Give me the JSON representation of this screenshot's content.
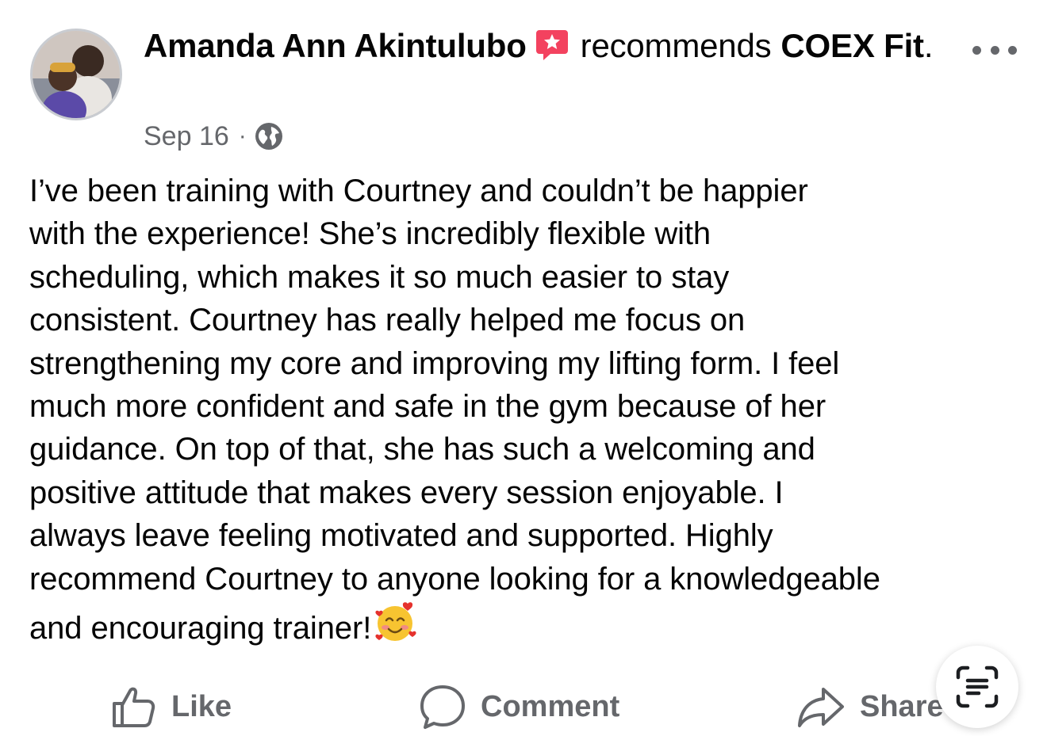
{
  "post": {
    "author": "Amanda Ann Akintulubo",
    "action_text": "recommends",
    "page_name": "COEX Fit",
    "date": "Sep 16",
    "separator": "·",
    "audience_icon": "globe-icon",
    "body_lines": [
      "I’ve been training with Courtney and couldn’t be happier",
      "with the experience! She’s incredibly flexible with",
      "scheduling, which makes it so much easier to stay",
      "consistent. Courtney has really helped me focus on",
      "strengthening my core and improving my lifting form. I feel",
      "much more confident and safe in the gym because of her",
      "guidance. On top of that, she has such a welcoming and",
      "positive attitude that makes every session enjoyable. I",
      "always leave feeling motivated and supported. Highly",
      "recommend Courtney to anyone looking for a knowledgeable",
      "and encouraging trainer!"
    ],
    "emoji": "smiling-face-with-hearts"
  },
  "actions": {
    "like_label": "Like",
    "comment_label": "Comment",
    "share_label": "Share"
  },
  "colors": {
    "text": "#050505",
    "secondary": "#65676b",
    "recommend_badge": "#f3425f",
    "avatar_border": "#c9ccd1"
  }
}
